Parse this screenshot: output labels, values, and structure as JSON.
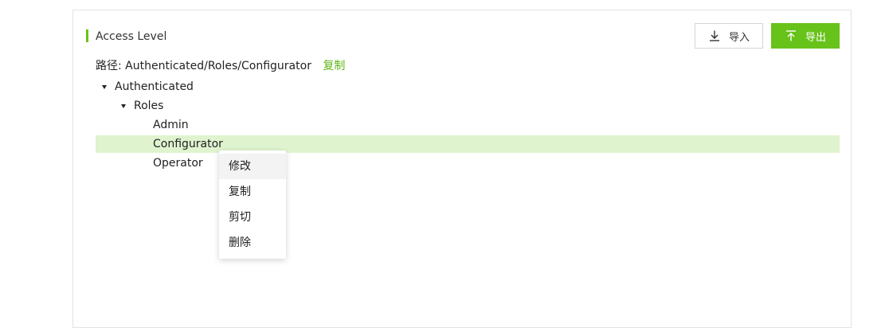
{
  "header": {
    "title": "Access Level",
    "import_label": "导入",
    "export_label": "导出"
  },
  "path": {
    "label": "路径:",
    "value": "Authenticated/Roles/Configurator",
    "copy_label": "复制"
  },
  "tree": {
    "root": "Authenticated",
    "group": "Roles",
    "children": [
      "Admin",
      "Configurator",
      "Operator"
    ],
    "selected": "Configurator"
  },
  "context_menu": {
    "items": [
      "修改",
      "复制",
      "剪切",
      "删除"
    ],
    "hovered": "修改"
  },
  "colors": {
    "accent": "#67c21a",
    "selected_row": "#dff3cf"
  },
  "icons": {
    "import": "download-icon",
    "export": "upload-icon"
  }
}
